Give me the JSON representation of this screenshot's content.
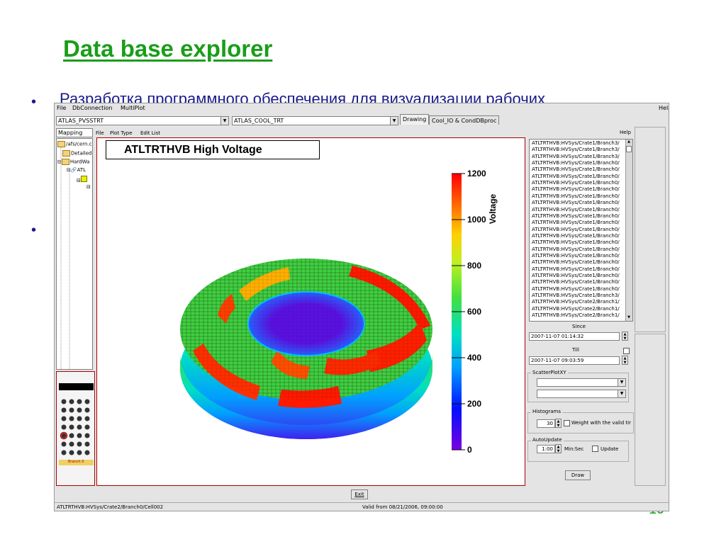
{
  "slide": {
    "title": "Data base explorer",
    "bullet_text": "Разработка программного обеспечения  для визуализации рабочих",
    "page_number": "19"
  },
  "app": {
    "menu": {
      "file": "File",
      "dbconnection": "DbConnection",
      "multiplot": "MultiPlot",
      "help": "Help"
    },
    "db_combo_1": "ATLAS_PVSSTRT",
    "db_combo_2": "ATLAS_COOL_TRT",
    "tabs": {
      "drawing": "Drawing",
      "cool": "Cool_IO & CondDBproc"
    },
    "mapping_tab": "Mapping",
    "submenu": {
      "file": "File",
      "plot_type": "Plot Type",
      "edit_list": "Edit List",
      "help": "Help"
    },
    "tree": {
      "root": "/afs/cern.ch",
      "detailed": "Detailed",
      "hardware": "HardWa",
      "atl": "ATL"
    },
    "thumb_caption": "Branch 0",
    "list_items": [
      "ATLTRTHVB:HVSys/Crate1/Branch3/",
      "ATLTRTHVB:HVSys/Crate1/Branch3/",
      "ATLTRTHVB:HVSys/Crate1/Branch3/",
      "ATLTRTHVB:HVSys/Crate1/Branch0/",
      "ATLTRTHVB:HVSys/Crate1/Branch0/",
      "ATLTRTHVB:HVSys/Crate1/Branch0/",
      "ATLTRTHVB:HVSys/Crate1/Branch0/",
      "ATLTRTHVB:HVSys/Crate1/Branch0/",
      "ATLTRTHVB:HVSys/Crate1/Branch0/",
      "ATLTRTHVB:HVSys/Crate1/Branch0/",
      "ATLTRTHVB:HVSys/Crate1/Branch0/",
      "ATLTRTHVB:HVSys/Crate1/Branch0/",
      "ATLTRTHVB:HVSys/Crate1/Branch0/",
      "ATLTRTHVB:HVSys/Crate1/Branch0/",
      "ATLTRTHVB:HVSys/Crate1/Branch0/",
      "ATLTRTHVB:HVSys/Crate1/Branch0/",
      "ATLTRTHVB:HVSys/Crate1/Branch0/",
      "ATLTRTHVB:HVSys/Crate1/Branch0/",
      "ATLTRTHVB:HVSys/Crate1/Branch0/",
      "ATLTRTHVB:HVSys/Crate1/Branch0/",
      "ATLTRTHVB:HVSys/Crate1/Branch0/",
      "ATLTRTHVB:HVSys/Crate1/Branch0/",
      "ATLTRTHVB:HVSys/Crate1/Branch0/",
      "ATLTRTHVB:HVSys/Crate1/Branch3/",
      "ATLTRTHVB:HVSys/Crate2/Branch1/",
      "ATLTRTHVB:HVSys/Crate2/Branch1/",
      "ATLTRTHVB:HVSys/Crate2/Branch1/"
    ],
    "since_label": "Since",
    "since_value": "2007-11-07 01:14:32",
    "till_label": "Till",
    "till_value": "2007-11-07 09:03:59",
    "scatter_label": "ScatterPlotXY",
    "histograms_label": "Histograms",
    "histograms_value": "30",
    "weight_label": "Weight with the valid tir",
    "autoupdate_label": "AutoUpdate",
    "autoupdate_value": "1:00",
    "minsec_label": "Min:Sec",
    "update_label": "Update",
    "draw_button": "Draw",
    "exit_button": "Exit",
    "status_left": "ATLTRTHVB:HVSys/Crate2/Branch0/Cell002",
    "status_right": "Valid from 08/21/2006, 09:00:00"
  },
  "chart_data": {
    "type": "heatmap",
    "title": "ATLTRTHVB High Voltage",
    "zlabel": "Voltage",
    "zlim": [
      0,
      1200
    ],
    "colorbar_ticks": [
      "0",
      "200",
      "400",
      "600",
      "800",
      "1000",
      "1200"
    ],
    "colorscale": [
      "#7a00e0",
      "#0010ff",
      "#00a0ff",
      "#00e0c0",
      "#40e040",
      "#c0f020",
      "#ffd000",
      "#ff7000",
      "#ff0000"
    ]
  }
}
